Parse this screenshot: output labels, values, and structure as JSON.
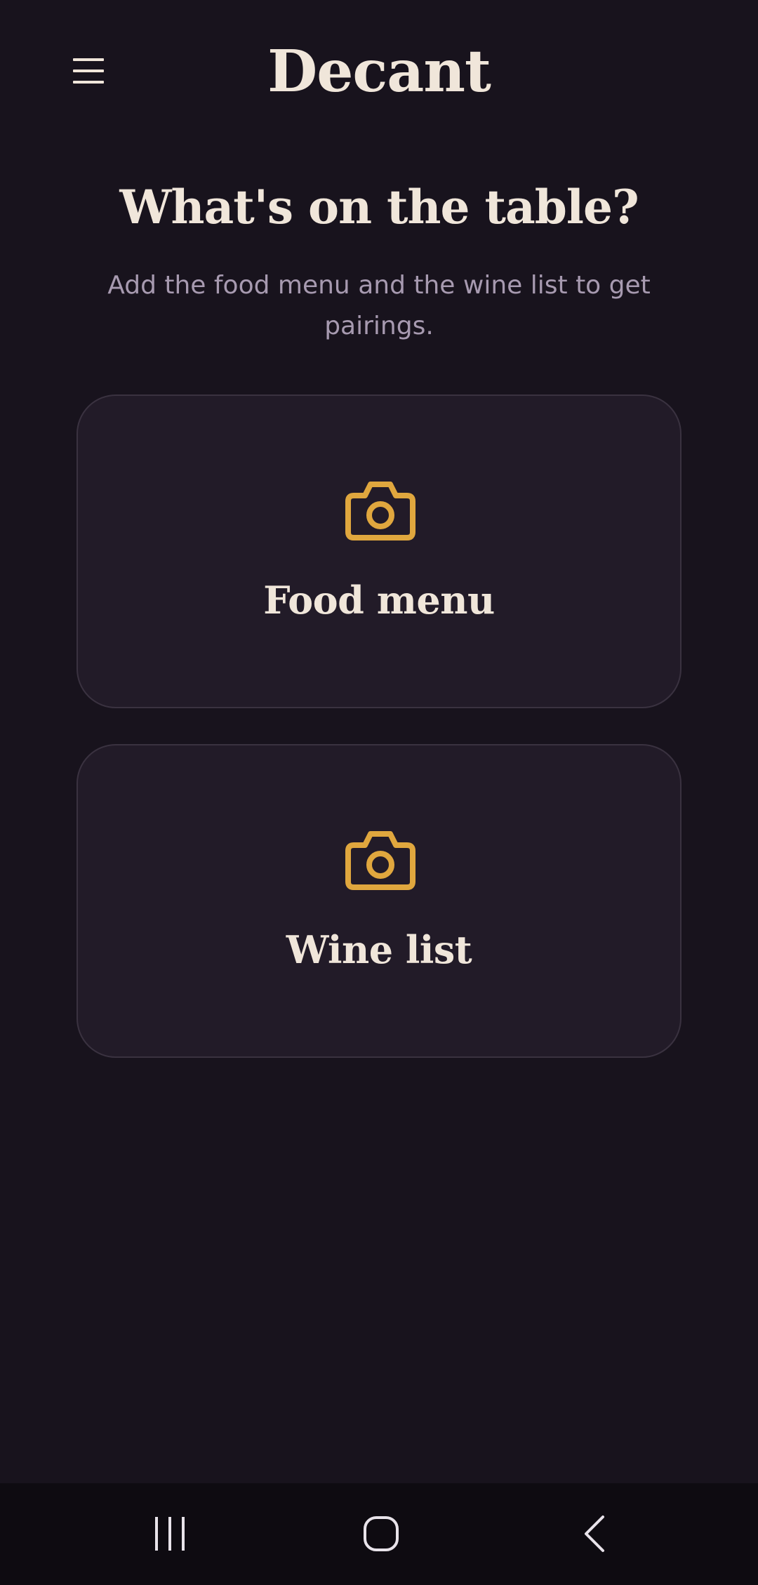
{
  "header": {
    "menu_icon": "hamburger-menu-icon",
    "app_title": "Decant"
  },
  "main": {
    "heading": "What's on the table?",
    "subtitle": "Add the food menu and the wine list to get pairings.",
    "cards": [
      {
        "label": "Food menu",
        "icon": "camera-icon"
      },
      {
        "label": "Wine list",
        "icon": "camera-icon"
      }
    ]
  },
  "navbar": {
    "recents_icon": "recent-apps-icon",
    "home_icon": "home-icon",
    "back_icon": "back-icon"
  },
  "colors": {
    "background": "#18131d",
    "card_background": "#221b28",
    "card_border": "#3a3240",
    "accent": "#e0a73e",
    "text_primary": "#f0e6da",
    "text_secondary": "#a79ab0",
    "navbar_background": "#0e0b11"
  }
}
